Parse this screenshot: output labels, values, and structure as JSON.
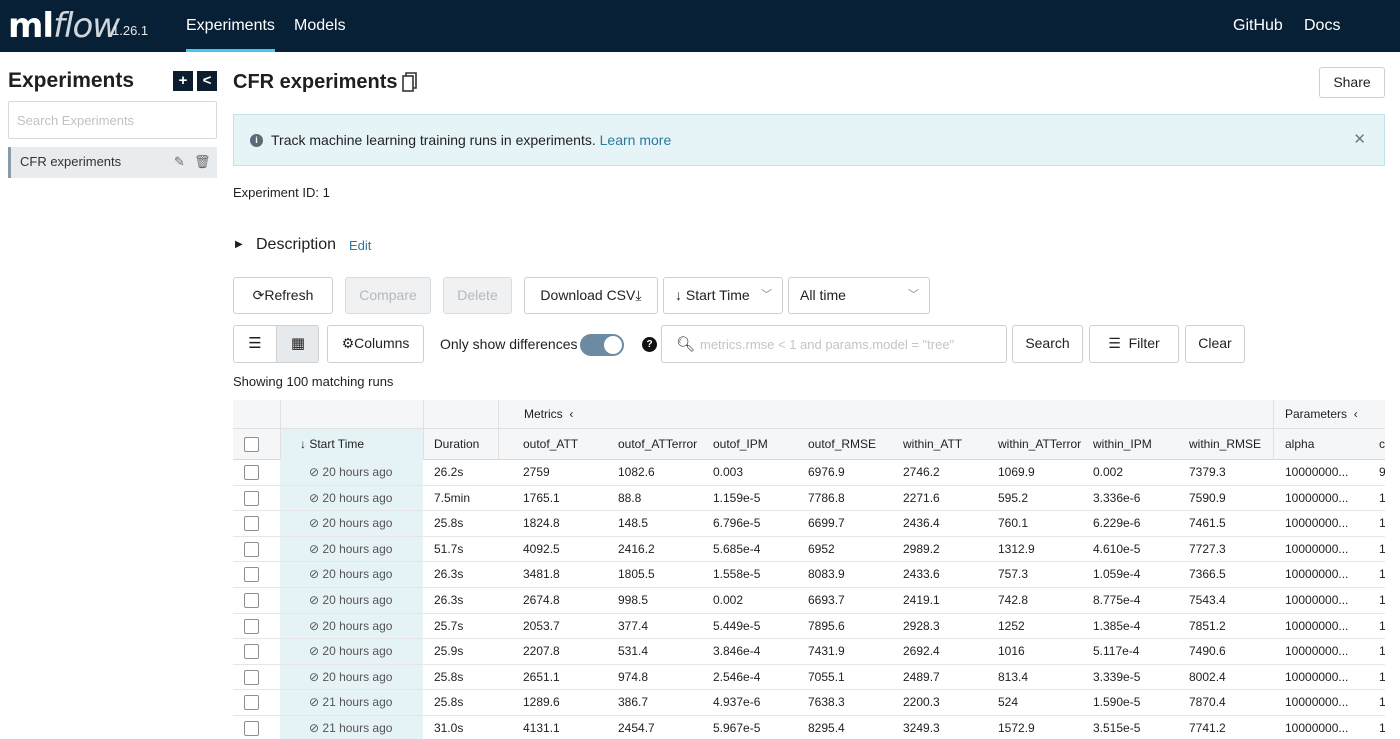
{
  "nav": {
    "logo_ml": "ml",
    "logo_flow": "flow",
    "version": "1.26.1",
    "links": [
      "Experiments",
      "Models"
    ],
    "right_links": [
      "GitHub",
      "Docs"
    ]
  },
  "sidebar": {
    "title": "Experiments",
    "search_placeholder": "Search Experiments",
    "items": [
      {
        "label": "CFR experiments"
      }
    ]
  },
  "header": {
    "title": "CFR experiments",
    "share_label": "Share"
  },
  "banner": {
    "text": "Track machine learning training runs in experiments.",
    "link": "Learn more"
  },
  "experiment": {
    "id_label": "Experiment ID:",
    "id_value": "1",
    "description_label": "Description",
    "edit_label": "Edit"
  },
  "toolbar": {
    "refresh": "Refresh",
    "compare": "Compare",
    "delete": "Delete",
    "download_csv": "Download CSV",
    "sort_by": "Start Time",
    "time_range": "All time",
    "columns": "Columns",
    "only_show_differences": "Only show differences",
    "search_placeholder": "metrics.rmse < 1 and params.model = \"tree\"",
    "search": "Search",
    "filter": "Filter",
    "clear": "Clear"
  },
  "runs_summary": "Showing 100 matching runs",
  "table": {
    "group_metrics": "Metrics",
    "group_parameters": "Parameters",
    "columns": [
      "Start Time",
      "Duration",
      "outof_ATT",
      "outof_ATTerror",
      "outof_IPM",
      "outof_RMSE",
      "within_ATT",
      "within_ATTerror",
      "within_IPM",
      "within_RMSE",
      "alpha",
      "c"
    ],
    "rows": [
      [
        "20 hours ago",
        "26.2s",
        "2759",
        "1082.6",
        "0.003",
        "6976.9",
        "2746.2",
        "1069.9",
        "0.002",
        "7379.3",
        "10000000...",
        "9"
      ],
      [
        "20 hours ago",
        "7.5min",
        "1765.1",
        "88.8",
        "1.159e-5",
        "7786.8",
        "2271.6",
        "595.2",
        "3.336e-6",
        "7590.9",
        "10000000...",
        "1"
      ],
      [
        "20 hours ago",
        "25.8s",
        "1824.8",
        "148.5",
        "6.796e-5",
        "6699.7",
        "2436.4",
        "760.1",
        "6.229e-6",
        "7461.5",
        "10000000...",
        "1"
      ],
      [
        "20 hours ago",
        "51.7s",
        "4092.5",
        "2416.2",
        "5.685e-4",
        "6952",
        "2989.2",
        "1312.9",
        "4.610e-5",
        "7727.3",
        "10000000...",
        "1"
      ],
      [
        "20 hours ago",
        "26.3s",
        "3481.8",
        "1805.5",
        "1.558e-5",
        "8083.9",
        "2433.6",
        "757.3",
        "1.059e-4",
        "7366.5",
        "10000000...",
        "1"
      ],
      [
        "20 hours ago",
        "26.3s",
        "2674.8",
        "998.5",
        "0.002",
        "6693.7",
        "2419.1",
        "742.8",
        "8.775e-4",
        "7543.4",
        "10000000...",
        "1"
      ],
      [
        "20 hours ago",
        "25.7s",
        "2053.7",
        "377.4",
        "5.449e-5",
        "7895.6",
        "2928.3",
        "1252",
        "1.385e-4",
        "7851.2",
        "10000000...",
        "1"
      ],
      [
        "20 hours ago",
        "25.9s",
        "2207.8",
        "531.4",
        "3.846e-4",
        "7431.9",
        "2692.4",
        "1016",
        "5.117e-4",
        "7490.6",
        "10000000...",
        "1"
      ],
      [
        "20 hours ago",
        "25.8s",
        "2651.1",
        "974.8",
        "2.546e-4",
        "7055.1",
        "2489.7",
        "813.4",
        "3.339e-5",
        "8002.4",
        "10000000...",
        "1"
      ],
      [
        "21 hours ago",
        "25.8s",
        "1289.6",
        "386.7",
        "4.937e-6",
        "7638.3",
        "2200.3",
        "524",
        "1.590e-5",
        "7870.4",
        "10000000...",
        "1"
      ],
      [
        "21 hours ago",
        "31.0s",
        "4131.1",
        "2454.7",
        "5.967e-5",
        "8295.4",
        "3249.3",
        "1572.9",
        "3.515e-5",
        "7741.2",
        "10000000...",
        "1"
      ]
    ]
  }
}
